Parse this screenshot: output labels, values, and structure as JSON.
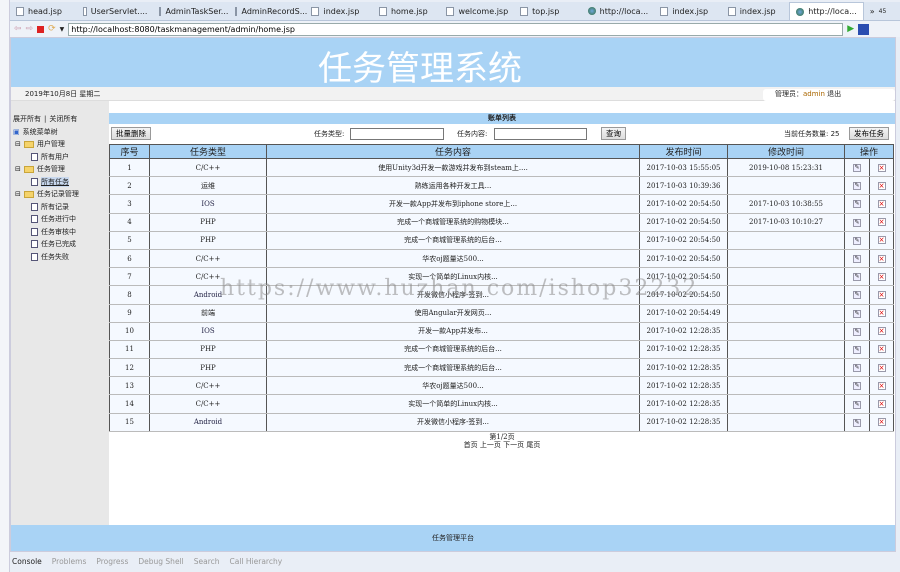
{
  "editor_tabs": [
    {
      "label": "head.jsp",
      "icon": "file"
    },
    {
      "label": "UserServlet....",
      "icon": "java"
    },
    {
      "label": "AdminTaskSer...",
      "icon": "java"
    },
    {
      "label": "AdminRecordS...",
      "icon": "java"
    },
    {
      "label": "index.jsp",
      "icon": "file"
    },
    {
      "label": "home.jsp",
      "icon": "file"
    },
    {
      "label": "welcome.jsp",
      "icon": "file"
    },
    {
      "label": "top.jsp",
      "icon": "file"
    },
    {
      "label": "http://loca...",
      "icon": "globe"
    },
    {
      "label": "index.jsp",
      "icon": "file"
    },
    {
      "label": "index.jsp",
      "icon": "file"
    },
    {
      "label": "http://loca...",
      "icon": "globe",
      "active": true
    }
  ],
  "overflow_count": "45",
  "url": "http://localhost:8080/taskmanagement/admin/home.jsp",
  "banner_title": "任务管理系统",
  "date": "2019年10月8日 星期二",
  "admin": {
    "label": "管理员：",
    "name": "admin",
    "logout": "退出"
  },
  "sidebar": {
    "expand_all": "展开所有",
    "sep": "|",
    "collapse_all": "关闭所有",
    "root": "系统菜单树",
    "groups": [
      {
        "label": "用户管理",
        "items": [
          "所有用户"
        ]
      },
      {
        "label": "任务管理",
        "items": [
          "所有任务"
        ]
      },
      {
        "label": "任务记录管理",
        "items": [
          "所有记录",
          "任务进行中",
          "任务审核中",
          "任务已完成",
          "任务失败"
        ]
      }
    ]
  },
  "list_title": "账单列表",
  "toolbar": {
    "batch_delete": "批量删除",
    "type_label": "任务类型:",
    "content_label": "任务内容:",
    "type_value": "",
    "content_value": "",
    "query": "查询",
    "count_label": "当前任务数量:",
    "count": "25",
    "publish": "发布任务"
  },
  "table": {
    "headers": [
      "序号",
      "任务类型",
      "任务内容",
      "发布时间",
      "修改时间",
      "操作"
    ],
    "rows": [
      [
        "1",
        "C/C++",
        "使用Unity3d开发一款游戏并发布到steam上....",
        "2017-10-03 15:55:05",
        "2019-10-08 15:23:31"
      ],
      [
        "2",
        "运维",
        "熟练运用各种开发工具...",
        "2017-10-03 10:39:36",
        ""
      ],
      [
        "3",
        "IOS",
        "开发一款App并发布到iphone store上...",
        "2017-10-02 20:54:50",
        "2017-10-03 10:38:55"
      ],
      [
        "4",
        "PHP",
        "完成一个商城管理系统的购物模块...",
        "2017-10-02 20:54:50",
        "2017-10-03 10:10:27"
      ],
      [
        "5",
        "PHP",
        "完成一个商城管理系统的后台...",
        "2017-10-02 20:54:50",
        ""
      ],
      [
        "6",
        "C/C++",
        "华农oj题量达500...",
        "2017-10-02 20:54:50",
        ""
      ],
      [
        "7",
        "C/C++",
        "实现一个简单的Linux内核...",
        "2017-10-02 20:54:50",
        ""
      ],
      [
        "8",
        "Android",
        "开发微信小程序-签到...",
        "2017-10-02 20:54:50",
        ""
      ],
      [
        "9",
        "前端",
        "使用Angular开发网页...",
        "2017-10-02 20:54:49",
        ""
      ],
      [
        "10",
        "IOS",
        "开发一款App并发布...",
        "2017-10-02 12:28:35",
        ""
      ],
      [
        "11",
        "PHP",
        "完成一个商城管理系统的后台...",
        "2017-10-02 12:28:35",
        ""
      ],
      [
        "12",
        "PHP",
        "完成一个商城管理系统的后台...",
        "2017-10-02 12:28:35",
        ""
      ],
      [
        "13",
        "C/C++",
        "华农oj题量达500...",
        "2017-10-02 12:28:35",
        ""
      ],
      [
        "14",
        "C/C++",
        "实现一个简单的Linux内核...",
        "2017-10-02 12:28:35",
        ""
      ],
      [
        "15",
        "Android",
        "开发微信小程序-签到...",
        "2017-10-02 12:28:35",
        ""
      ]
    ]
  },
  "pager": {
    "page": "第1/2页",
    "links": [
      "首页",
      "上一页",
      "下一页",
      "尾页"
    ]
  },
  "footer": "任务管理平台",
  "bottom_views": [
    "Console",
    "Problems",
    "Progress",
    "Debug Shell",
    "Search",
    "Call Hierarchy"
  ],
  "watermark": "https://www.huzhan.com/ishop32232"
}
